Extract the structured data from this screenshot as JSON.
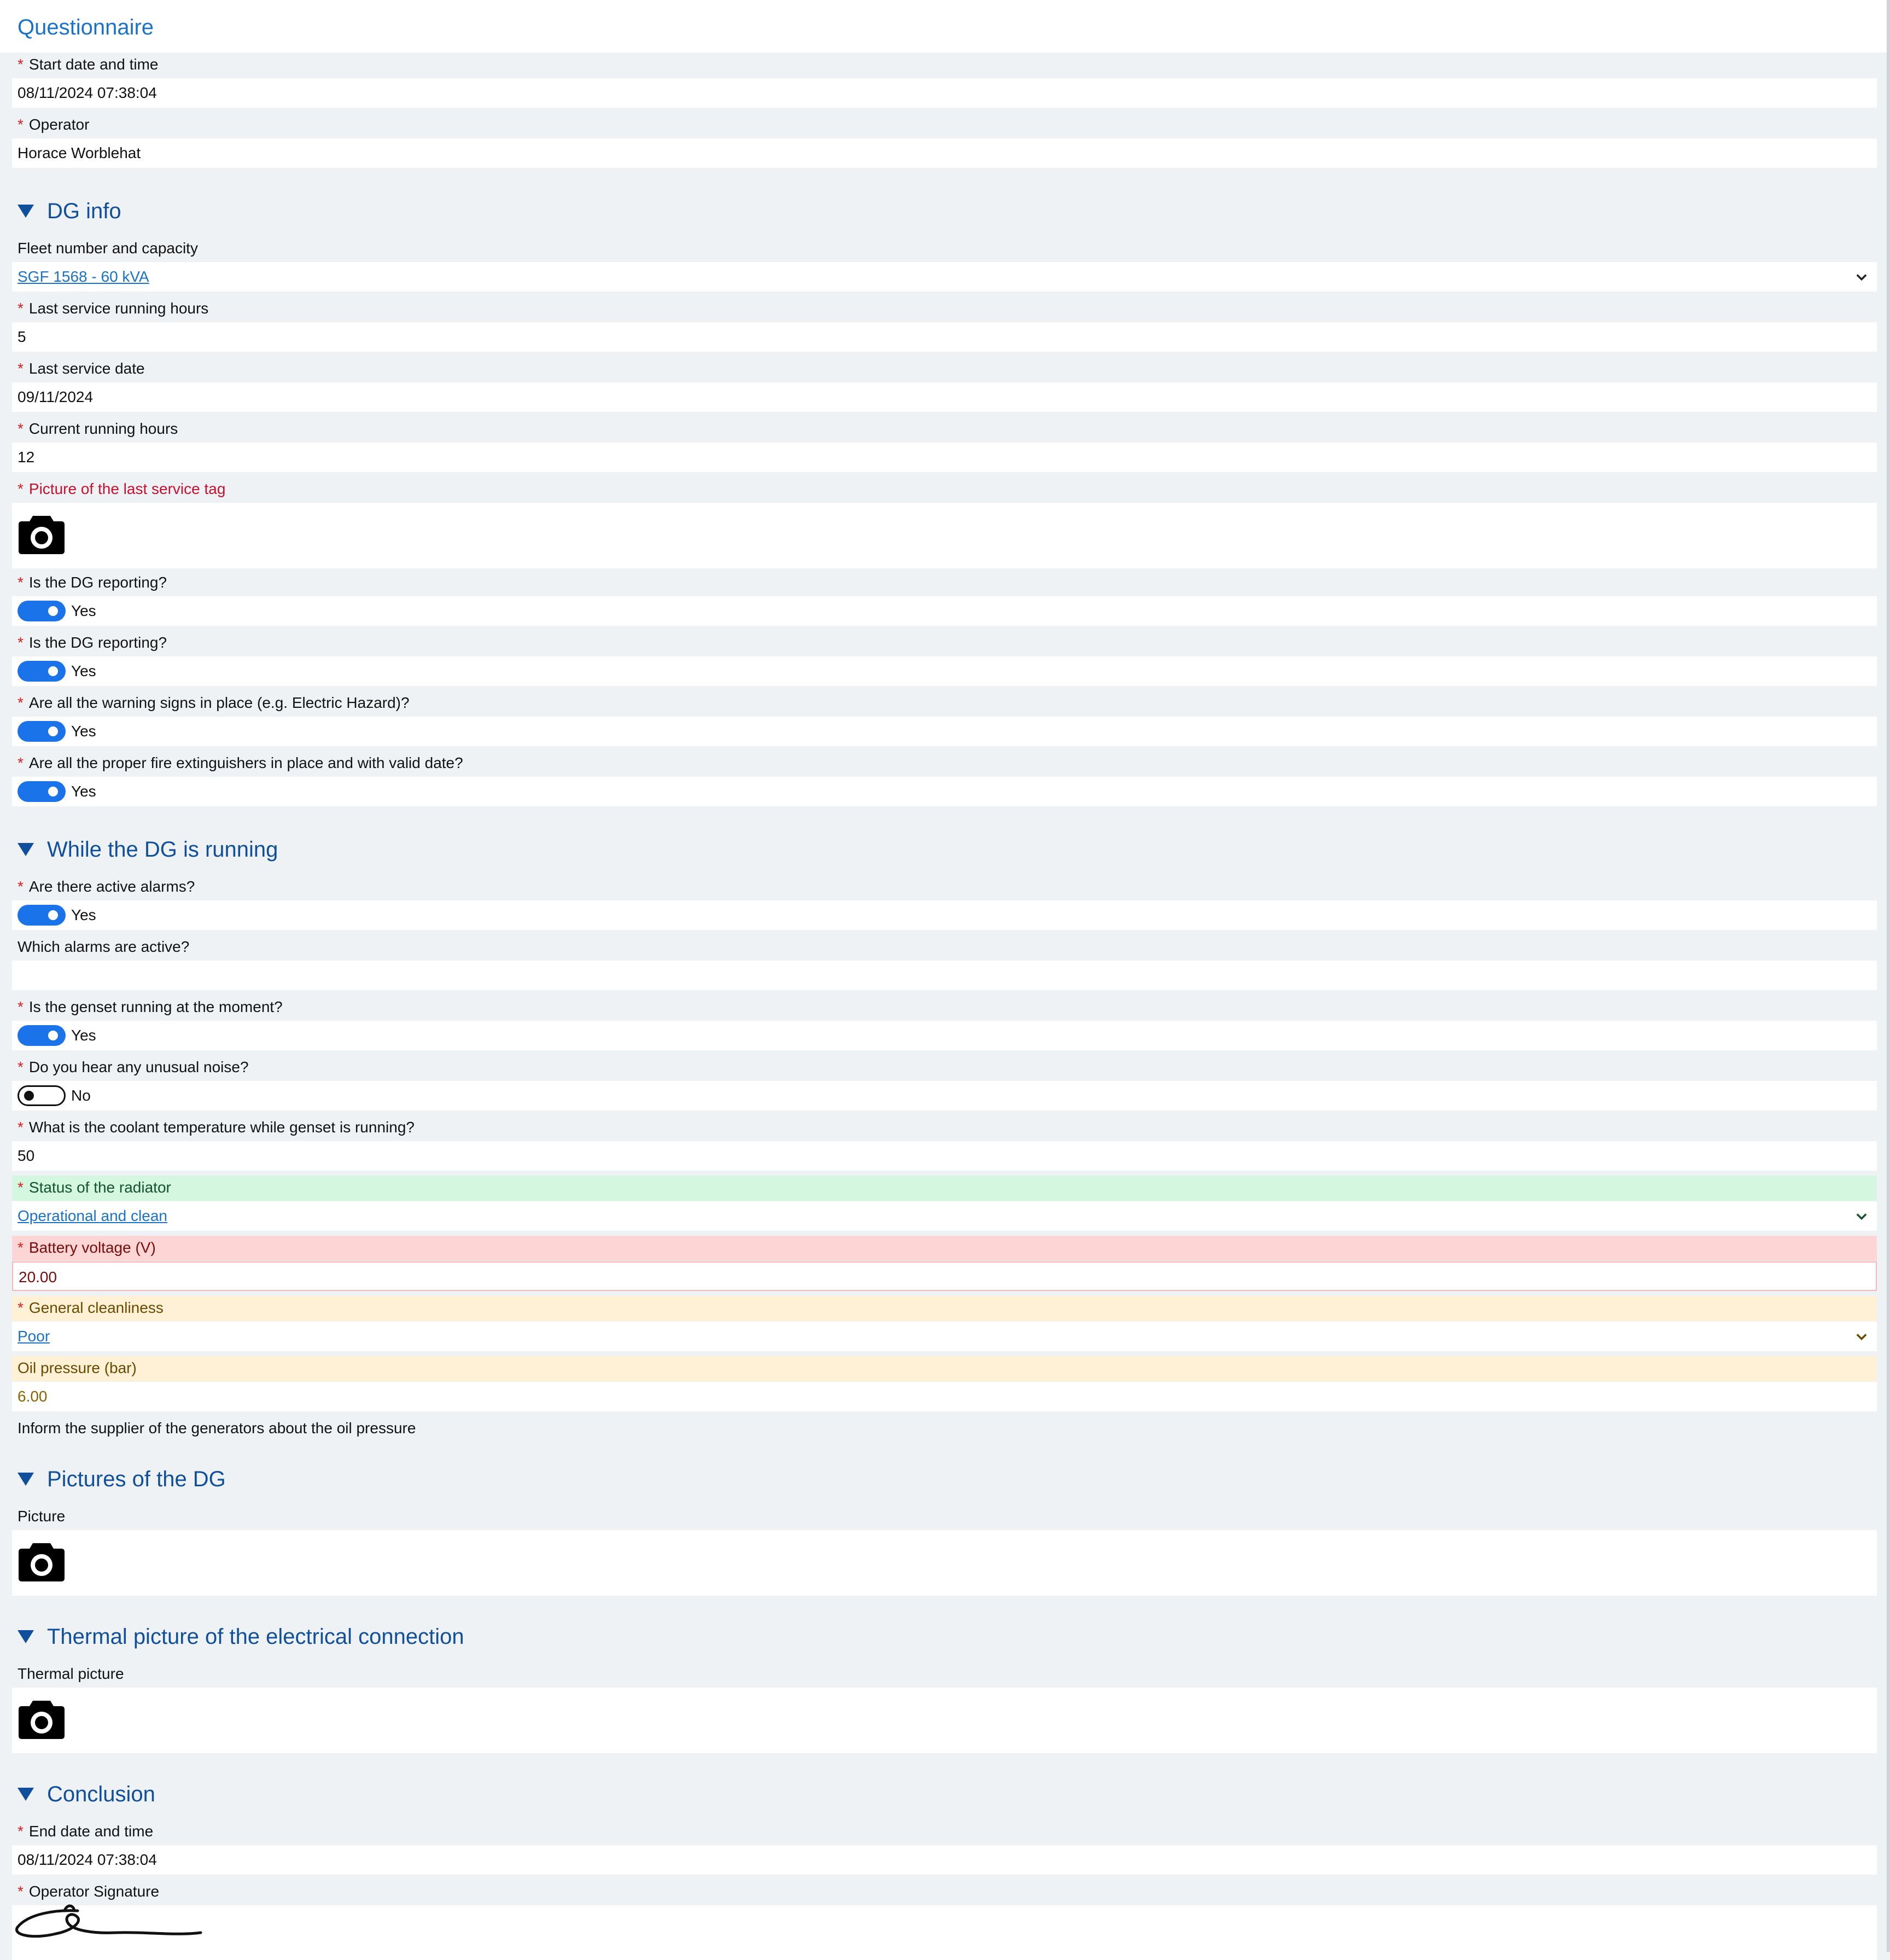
{
  "page": {
    "title": "Questionnaire"
  },
  "header_fields": {
    "start": {
      "label": "Start date and time",
      "value": "08/11/2024 07:38:04"
    },
    "operator": {
      "label": "Operator",
      "value": "Horace Worblehat"
    }
  },
  "dg_info": {
    "title": "DG info",
    "fleet": {
      "label": "Fleet number and capacity",
      "value": "SGF 1568 - 60 kVA"
    },
    "last_service_hours": {
      "label": "Last service running hours",
      "value": "5"
    },
    "last_service_date": {
      "label": "Last service date",
      "value": "09/11/2024"
    },
    "current_hours": {
      "label": "Current running hours",
      "value": "12"
    },
    "service_tag_picture": {
      "label": "Picture of the last service tag"
    },
    "reporting_1": {
      "label": "Is the DG reporting?",
      "value": "Yes"
    },
    "reporting_2": {
      "label": "Is the DG reporting?",
      "value": "Yes"
    },
    "warning_signs": {
      "label": "Are all the warning signs in place (e.g. Electric Hazard)?",
      "value": "Yes"
    },
    "fire_extinguishers": {
      "label": "Are all the proper fire extinguishers in place and with valid date?",
      "value": "Yes"
    }
  },
  "running": {
    "title": "While the DG is running",
    "active_alarms": {
      "label": "Are there active alarms?",
      "value": "Yes"
    },
    "which_alarms": {
      "label": "Which alarms are active?",
      "value": ""
    },
    "genset_running": {
      "label": "Is the genset running at the moment?",
      "value": "Yes"
    },
    "unusual_noise": {
      "label": "Do you hear any unusual noise?",
      "value": "No"
    },
    "coolant_temp": {
      "label": "What is the coolant temperature while genset is running?",
      "value": "50"
    },
    "radiator": {
      "label": "Status of the radiator",
      "value": "Operational and clean"
    },
    "battery": {
      "label": "Battery voltage (V)",
      "value": "20.00"
    },
    "cleanliness": {
      "label": "General cleanliness",
      "value": "Poor"
    },
    "oil_pressure": {
      "label": "Oil pressure (bar)",
      "value": "6.00"
    },
    "oil_note": "Inform the supplier of the generators about the oil pressure"
  },
  "pictures": {
    "title": "Pictures of the DG",
    "picture": {
      "label": "Picture"
    }
  },
  "thermal": {
    "title": "Thermal picture of the electrical connection",
    "picture": {
      "label": "Thermal picture"
    }
  },
  "conclusion": {
    "title": "Conclusion",
    "end": {
      "label": "End date and time",
      "value": "08/11/2024 07:38:04"
    },
    "signature": {
      "label": "Operator Signature"
    }
  },
  "icons": {
    "required": "asterisk",
    "section": "triangle-down-icon",
    "dropdown": "chevron-down-icon",
    "camera": "camera-icon"
  },
  "colors": {
    "accent": "#1a73e8",
    "section_title": "#0f4f9c",
    "required_mark": "#d92020",
    "ok_bg": "#d3f7df",
    "error_bg": "#fdd5d5",
    "warning_bg": "#fff1d6"
  }
}
